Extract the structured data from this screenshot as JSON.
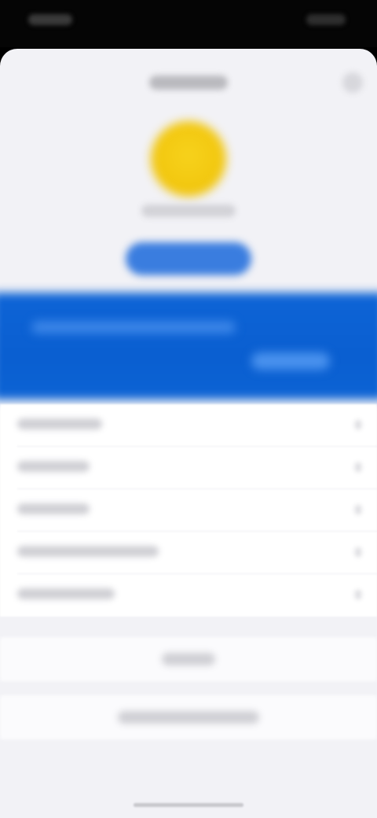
{
  "status_bar": {
    "time": "",
    "indicators": ""
  },
  "header": {
    "title": "",
    "close_icon": "close-icon"
  },
  "profile": {
    "avatar_color": "#F2C70F",
    "name": "",
    "primary_button_label": ""
  },
  "banner": {
    "color": "#0A5FD1",
    "text": "",
    "button_label": ""
  },
  "list": {
    "items": [
      {
        "label": ""
      },
      {
        "label": ""
      },
      {
        "label": ""
      },
      {
        "label": ""
      },
      {
        "label": ""
      }
    ]
  },
  "footer": {
    "action_1": "",
    "action_2": ""
  }
}
